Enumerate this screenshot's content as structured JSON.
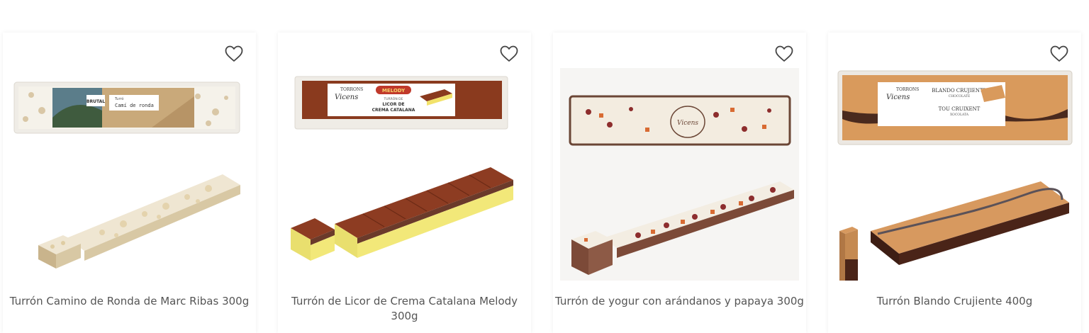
{
  "products": [
    {
      "name": "Turrón Camino de Ronda de Marc Ribas 300g",
      "image_label_brand": "BRUTAL",
      "image_label_title": "Camí de ronda",
      "image_label_sub": "Turró"
    },
    {
      "name": "Turrón de Licor de Crema Catalana Melody 300g",
      "image_label_brand": "TORRONS",
      "image_label_brand2": "Vicens",
      "image_label_logo": "MELODY",
      "image_label_title_1": "LICOR DE",
      "image_label_title_2": "CREMA CATALANA",
      "image_label_sub": "TURRÓN DE"
    },
    {
      "name": "Turrón de yogur con arándanos y papaya 300g",
      "image_label_brand": "Vicens"
    },
    {
      "name": "Turrón Blando Crujiente 400g",
      "image_label_brand": "TORRONS",
      "image_label_brand2": "Vicens",
      "image_label_title_1": "BLANDO CRUJIENTE",
      "image_label_title_2": "TOU CRUIXENT",
      "image_label_sub_1": "CHOCOLATE",
      "image_label_sub_2": "XOCOLATA"
    }
  ],
  "icons": {
    "favorite": "heart-outline-icon"
  },
  "colors": {
    "card_bg": "#ffffff",
    "title_text": "#555555",
    "heart_stroke": "#444444"
  }
}
